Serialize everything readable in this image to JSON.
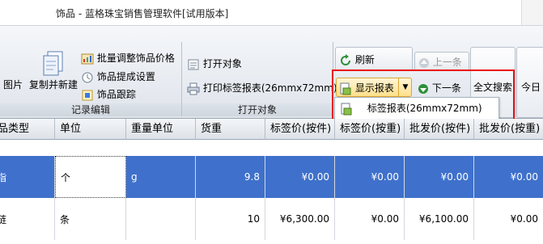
{
  "window": {
    "title": "饰品 - 蓝格珠宝销售管理软件[试用版本]"
  },
  "ribbon": {
    "record_group": {
      "label": "记录编辑",
      "image_label": "图片",
      "copy_new_label": "复制并新建",
      "batch_price_label": "批量调整饰品价格",
      "commission_label": "饰品提成设置",
      "track_label": "饰品跟踪"
    },
    "open_group": {
      "label": "打开对象",
      "open_object_label": "打开对象",
      "print_label": "打印标签报表(26mmx72mm)"
    },
    "refresh_label": "刷新",
    "show_report_label": "显示报表",
    "prev_label": "上一条",
    "next_label": "下一条",
    "fulltext_label": "全文搜索",
    "today_label": "今日",
    "dropdown": {
      "item_label": "标签报表(26mmx72mm)"
    }
  },
  "table": {
    "columns": [
      "饰品类型",
      "单位",
      "重量单位",
      "货重",
      "标签价(按件)",
      "标签价(按重)",
      "批发价(按件)",
      "批发价(按重)"
    ],
    "rows": [
      {
        "type": "戒指",
        "unit": "个",
        "weight_unit": "g",
        "weight": "9.8",
        "tag_piece": "¥0.00",
        "tag_weight": "¥0.00",
        "whole_piece": "¥0.00",
        "whole_weight": "¥0.00"
      },
      {
        "type": "项链",
        "unit": "条",
        "weight_unit": "",
        "weight": "10",
        "tag_piece": "¥6,300.00",
        "tag_weight": "¥0.00",
        "whole_piece": "¥6,100.00",
        "whole_weight": "¥0.00"
      }
    ]
  },
  "colors": {
    "selected_row": "#3f71cc",
    "highlight_border": "#e11111"
  },
  "icons": [
    "document-icon",
    "copy-icon",
    "price-adjust-icon",
    "commission-icon",
    "track-icon",
    "open-icon",
    "print-icon",
    "refresh-icon",
    "report-icon",
    "chevron-down-icon",
    "up-arrow-icon",
    "down-arrow-icon"
  ]
}
